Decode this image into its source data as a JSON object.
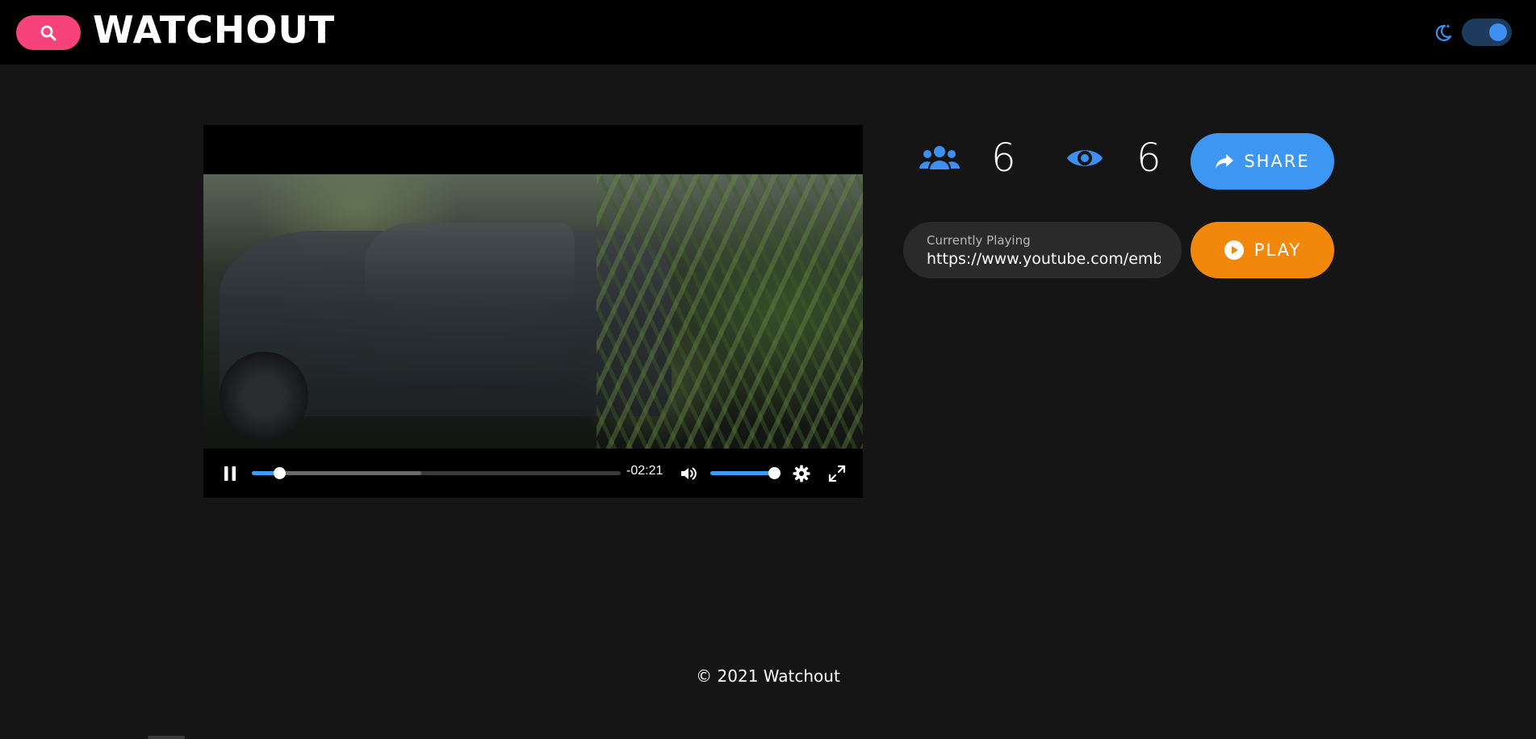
{
  "header": {
    "logo_text": "WATCHOUT",
    "search_icon": "search-icon",
    "theme_icon": "moon-stars-icon",
    "dark_mode_on": true
  },
  "colors": {
    "search_button": "#f7437c",
    "accent_blue": "#3d97f2",
    "play_orange": "#f2880b",
    "background": "#151515",
    "header_bg": "#000000"
  },
  "player": {
    "time_remaining": "-02:21",
    "progress_fraction": 0.075,
    "buffered_fraction": 0.46,
    "volume_fraction": 0.96,
    "icons": [
      "pause-icon",
      "volume-icon",
      "gear-icon",
      "fullscreen-icon"
    ]
  },
  "stats": {
    "users": "6",
    "views": "6",
    "users_icon": "users-icon",
    "views_icon": "eye-icon"
  },
  "share": {
    "label": "SHARE",
    "icon": "share-arrow-icon"
  },
  "currently_playing": {
    "label": "Currently Playing",
    "value": "https://www.youtube.com/emb"
  },
  "play": {
    "label": "PLAY",
    "icon": "play-circle-icon"
  },
  "footer": {
    "copyright": "© 2021 Watchout"
  }
}
